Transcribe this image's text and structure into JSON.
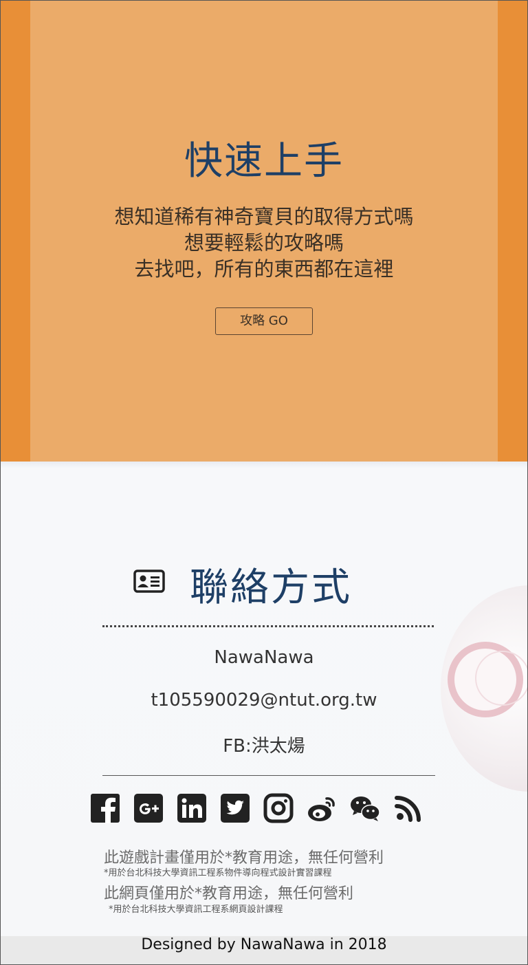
{
  "hero": {
    "title": "快速上手",
    "lines": [
      "想知道稀有神奇寶貝的取得方式嗎",
      "想要輕鬆的攻略嗎",
      "去找吧，所有的東西都在這裡"
    ],
    "button_label": "攻略 GO",
    "colors": {
      "outer": "#e88f37",
      "inner": "#ebab69",
      "title": "#1e3f66"
    }
  },
  "contact": {
    "icon": "id-card-icon",
    "title": "聯絡方式",
    "name": "NawaNawa",
    "email": "t105590029@ntut.org.tw",
    "fb": "FB:洪太煬",
    "social_icons": [
      "facebook-icon",
      "google-plus-icon",
      "linkedin-icon",
      "twitter-icon",
      "instagram-icon",
      "weibo-icon",
      "wechat-icon",
      "rss-icon"
    ],
    "disclaimers": [
      {
        "main": "此遊戲計畫僅用於*教育用途，無任何營利",
        "note": "*用於台北科技大學資訊工程系物件導向程式設計實習課程"
      },
      {
        "main": "此網頁僅用於*教育用途，無任何營利",
        "note": "*用於台北科技大學資訊工程系網頁設計課程"
      }
    ]
  },
  "footer": {
    "text": "Designed by NawaNawa in 2018"
  }
}
